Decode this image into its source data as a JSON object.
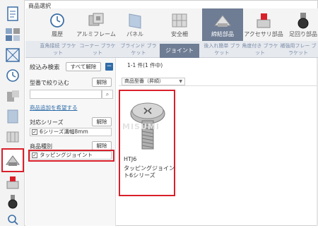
{
  "header": {
    "title": "商品選択"
  },
  "categories": [
    {
      "label": "履歴",
      "icon": "history-icon"
    },
    {
      "label": "アルミフレーム",
      "icon": "aluminum-frame-icon"
    },
    {
      "label": "パネル",
      "icon": "panel-icon"
    },
    {
      "label": "安全柵",
      "icon": "safety-fence-icon"
    },
    {
      "label": "締結部品",
      "icon": "fastener-icon",
      "active": true
    },
    {
      "label": "アクセサリ部品",
      "icon": "accessory-icon"
    },
    {
      "label": "足回り部品",
      "icon": "caster-icon"
    }
  ],
  "subtabs": [
    {
      "label": "直角接続 ブラケット"
    },
    {
      "label": "コーナー ブラケット"
    },
    {
      "label": "ブラインド ブラケット"
    },
    {
      "label": "ジョイント",
      "active": true
    },
    {
      "label": "後入れ簡単 ブラケット"
    },
    {
      "label": "角度付き ブラケット"
    },
    {
      "label": "補強用フレー ブラケット"
    }
  ],
  "filters": {
    "title": "絞込み検索",
    "clear_all": "すべて解除",
    "collapse": "−",
    "model_label": "型番で絞り込む",
    "clear": "解除",
    "search_placeholder": "",
    "request_link": "商品追加を希望する",
    "series_label": "対応シリーズ",
    "series_value": "6シリーズ溝幅8mm",
    "type_label": "商品種別",
    "type_value": "タッピングジョイント"
  },
  "results": {
    "count": "1-1 件(1 件中)",
    "sort_label": "商品型番（昇順）",
    "items": [
      {
        "code": "HTJ6",
        "name": "タッピングジョイント6シリーズ",
        "watermark": "MISUMI"
      }
    ]
  },
  "sidebar_icons": [
    "document-icon",
    "parts-grid-icon",
    "frame-icon",
    "history-icon",
    "parts-icon",
    "panel-icon",
    "fence-icon",
    "fastener-icon",
    "accessory-icon",
    "caster-icon",
    "search-icon"
  ],
  "colors": {
    "highlight": "#d9202a",
    "active_tab": "#6e7c94",
    "link": "#2d6ca8"
  }
}
